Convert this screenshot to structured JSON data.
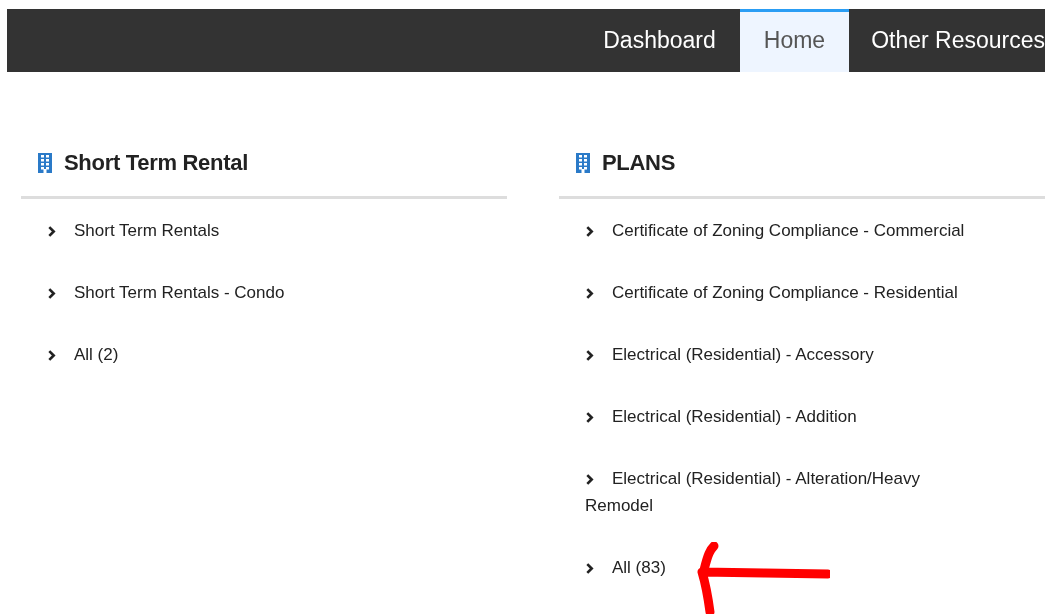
{
  "nav": {
    "tabs": [
      {
        "label": "Dashboard",
        "selected": false
      },
      {
        "label": "Home",
        "selected": true
      },
      {
        "label": "Other Resources",
        "selected": false
      }
    ]
  },
  "sections": [
    {
      "title": "Short Term Rental",
      "items": [
        {
          "label": "Short Term Rentals"
        },
        {
          "label": "Short Term Rentals - Condo"
        },
        {
          "label": "All (2)"
        }
      ]
    },
    {
      "title": "PLANS",
      "items": [
        {
          "label": "Certificate of Zoning Compliance - Commercial"
        },
        {
          "label": "Certificate of Zoning Compliance - Residential"
        },
        {
          "label": "Electrical (Residential) - Accessory"
        },
        {
          "label": "Electrical (Residential) - Addition"
        },
        {
          "label": "Electrical (Residential) - Alteration/Heavy Remodel"
        },
        {
          "label": "All (83)"
        }
      ]
    }
  ]
}
